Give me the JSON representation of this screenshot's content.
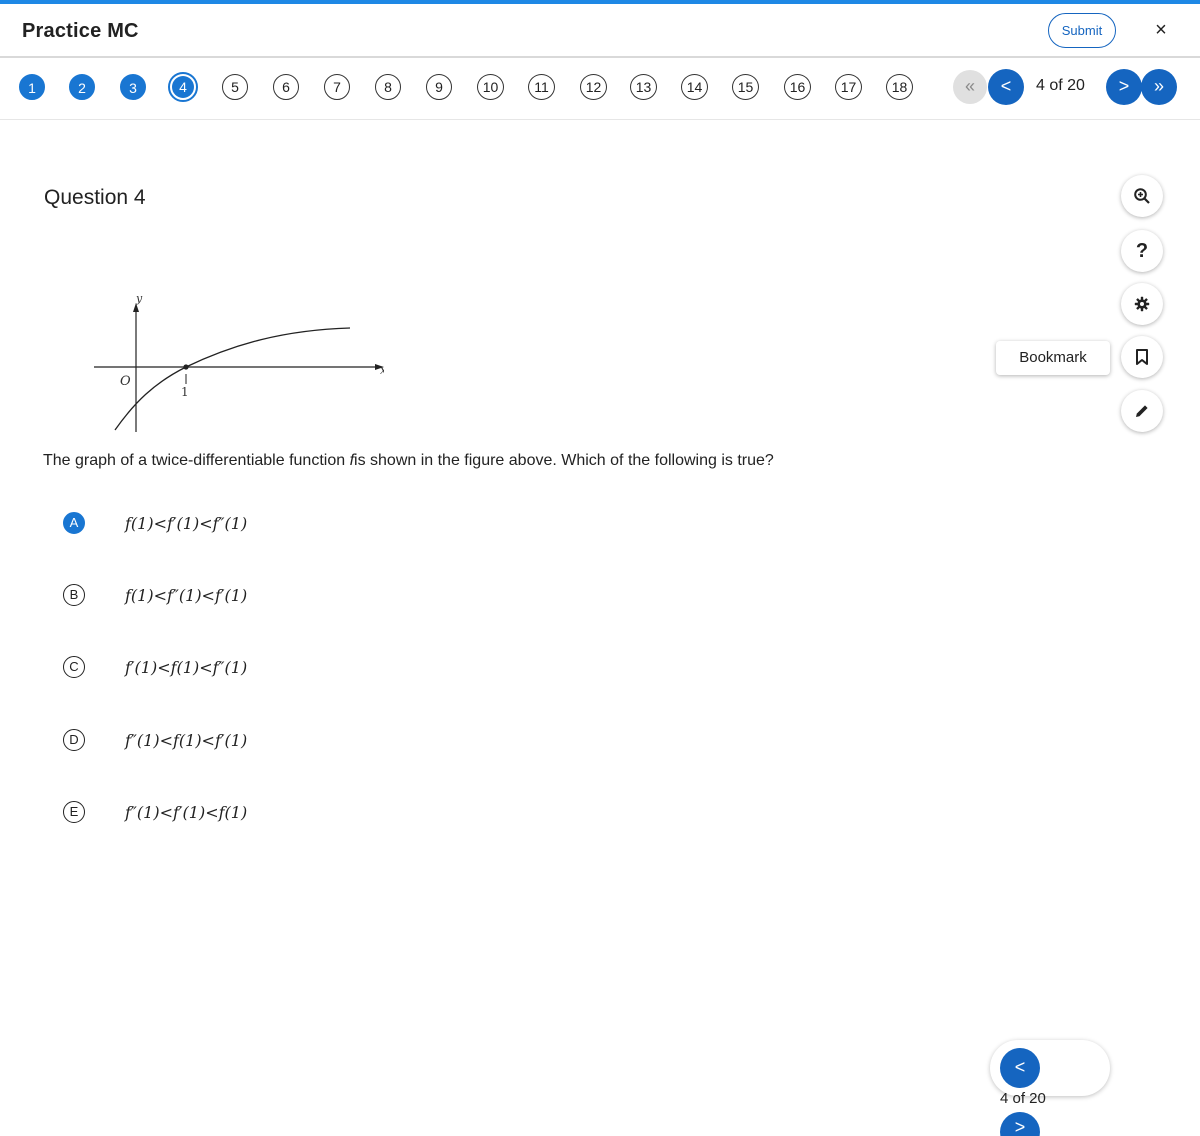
{
  "header": {
    "title": "Practice MC",
    "submit_label": "Submit",
    "close_label": "×"
  },
  "question_nav": {
    "items": [
      {
        "label": "1",
        "state": "answered"
      },
      {
        "label": "2",
        "state": "answered"
      },
      {
        "label": "3",
        "state": "answered"
      },
      {
        "label": "4",
        "state": "current"
      },
      {
        "label": "5",
        "state": "unanswered"
      },
      {
        "label": "6",
        "state": "unanswered"
      },
      {
        "label": "7",
        "state": "unanswered"
      },
      {
        "label": "8",
        "state": "unanswered"
      },
      {
        "label": "9",
        "state": "unanswered"
      },
      {
        "label": "10",
        "state": "unanswered"
      },
      {
        "label": "11",
        "state": "unanswered"
      },
      {
        "label": "12",
        "state": "unanswered"
      },
      {
        "label": "13",
        "state": "unanswered"
      },
      {
        "label": "14",
        "state": "unanswered"
      },
      {
        "label": "15",
        "state": "unanswered"
      },
      {
        "label": "16",
        "state": "unanswered"
      },
      {
        "label": "17",
        "state": "unanswered"
      },
      {
        "label": "18",
        "state": "unanswered"
      }
    ],
    "first_icon": "«",
    "prev_icon": "<",
    "position_text": "4 of 20",
    "next_icon": ">",
    "last_icon": "»"
  },
  "question": {
    "heading": "Question 4",
    "text_before": "The graph of a twice-differentiable function ",
    "text_var": "f",
    "text_after": "is shown in the figure above. Which of the following is true?",
    "figure": {
      "y_label": "y",
      "x_label": "x",
      "origin_label": "O",
      "tick_label": "1"
    },
    "choices": [
      {
        "letter": "A",
        "text": "f(1)<f′(1)<f″(1)",
        "selected": true
      },
      {
        "letter": "B",
        "text": "f(1)<f″(1)<f′(1)",
        "selected": false
      },
      {
        "letter": "C",
        "text": "f′(1)<f(1)<f″(1)",
        "selected": false
      },
      {
        "letter": "D",
        "text": "f″(1)<f(1)<f′(1)",
        "selected": false
      },
      {
        "letter": "E",
        "text": "f″(1)<f′(1)<f(1)",
        "selected": false
      }
    ]
  },
  "tools": {
    "zoom_icon": "zoom-in-icon",
    "help_label": "?",
    "settings_icon": "gear-icon",
    "bookmark_label": "Bookmark",
    "bookmark_icon": "bookmark-icon",
    "annotate_icon": "pencil-icon"
  },
  "mini_nav": {
    "prev_icon": "<",
    "position_text": "4 of 20",
    "next_icon": ">"
  },
  "colors": {
    "accent": "#1976d2",
    "accent_dark": "#1565c0",
    "top_bar": "#1e88e5"
  }
}
